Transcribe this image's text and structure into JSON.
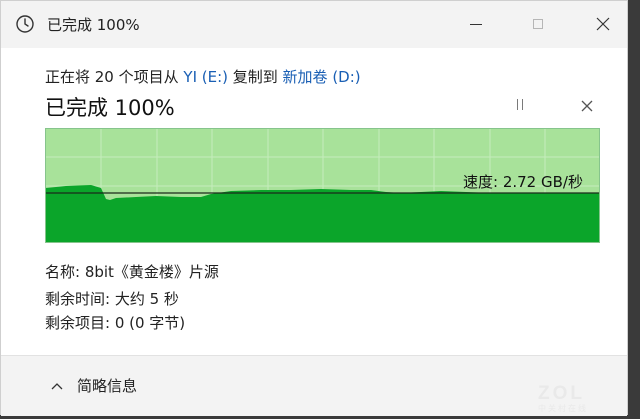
{
  "window": {
    "title": "已完成 100%"
  },
  "dialog": {
    "from_prefix": "正在将 20 个项目从 ",
    "from_source": "YI (E:)",
    "from_mid": " 复制到 ",
    "from_dest": "新加卷 (D:)",
    "status": "已完成 100%",
    "speed": "速度: 2.72 GB/秒",
    "name": "名称:  8bit《黄金楼》片源",
    "time_remaining": "剩余时间:  大约 5 秒",
    "items_remaining": "剩余项目:  0 (0 字节)",
    "details_toggle": "简略信息"
  },
  "colors": {
    "graph_light": "#a8e29a",
    "graph_dark": "#0ba52a",
    "link": "#1a5fb4"
  },
  "chart_data": {
    "type": "area",
    "progress_percent": 100,
    "current_speed": "2.72 GB/秒"
  },
  "icons": {
    "title": "clock-icon",
    "pause": "pause-icon",
    "close": "close-icon",
    "chevron": "chevron-up-icon"
  },
  "watermark": {
    "logo": "ZOL",
    "sub": "中关村在线"
  }
}
